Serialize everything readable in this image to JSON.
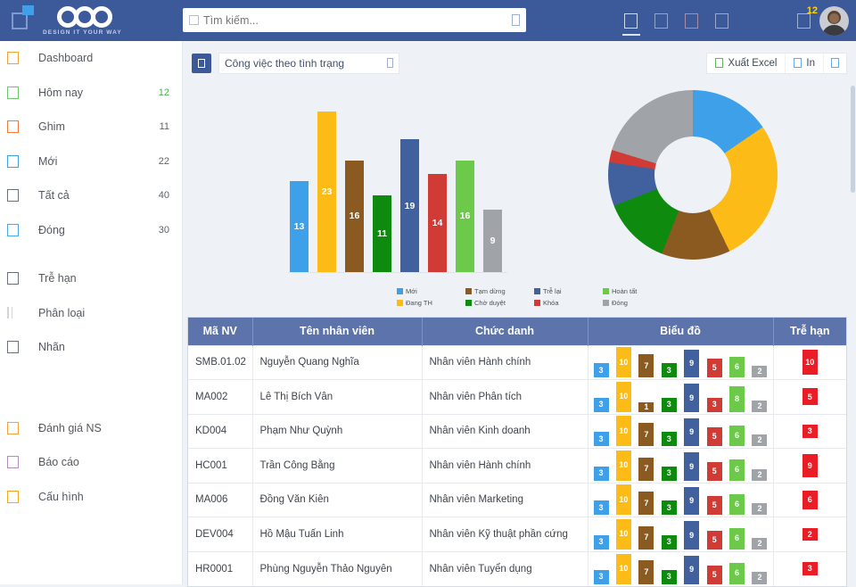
{
  "topbar": {
    "menu_icon": "hamburger-square-icon",
    "logo_tagline": "DESIGN IT YOUR WAY",
    "search": {
      "placeholder": "Tìm kiếm...",
      "value": ""
    },
    "nav_icons": [
      "nav-icon-1",
      "nav-icon-2",
      "nav-icon-3",
      "nav-icon-4"
    ],
    "notification_count": "12",
    "avatar_alt": "user-avatar"
  },
  "sidebar": {
    "items": [
      {
        "label": "Dashboard",
        "count": "",
        "icon": "dashboard-icon",
        "color": "#f0a33c"
      },
      {
        "label": "Hôm nay",
        "count": "12",
        "icon": "today-icon",
        "color": "#6dc46d",
        "count_color": "#4caf50"
      },
      {
        "label": "Ghim",
        "count": "11",
        "icon": "pin-icon",
        "color": "#ef7a3c"
      },
      {
        "label": "Mới",
        "count": "22",
        "icon": "new-icon",
        "color": "#3ea0e8"
      },
      {
        "label": "Tất cả",
        "count": "40",
        "icon": "all-icon",
        "color": "#6b7179"
      },
      {
        "label": "Đóng",
        "count": "30",
        "icon": "closed-icon",
        "color": "#49a9e8"
      }
    ],
    "items2": [
      {
        "label": "Trễ hạn",
        "icon": "overdue-icon",
        "color": "#6b7179"
      },
      {
        "label": "Phân loại",
        "icon": "category-bars-icon",
        "color": "#b8c0c9"
      },
      {
        "label": "Nhãn",
        "icon": "tag-icon",
        "color": "#6b7179"
      }
    ],
    "items3": [
      {
        "label": "Đánh giá NS",
        "icon": "evaluation-icon",
        "color": "#f0a33c"
      },
      {
        "label": "Báo cáo",
        "icon": "report-icon",
        "color": "#b48ac0"
      },
      {
        "label": "Cấu hình",
        "icon": "settings-icon",
        "color": "#f5a623"
      }
    ]
  },
  "panel": {
    "widget_icon": "widget-icon",
    "select_value": "Công việc theo tình trạng",
    "export_excel": "Xuất Excel",
    "print": "In",
    "more_icon": "more-options-icon"
  },
  "chart_data": [
    {
      "type": "bar",
      "title": "Công việc theo tình trạng",
      "categories": [
        "Mới",
        "Đang TH",
        "Tạm dừng",
        "Chờ duyệt",
        "Trễ lại",
        "Khóa",
        "Hoàn tất",
        "Đóng"
      ],
      "values": [
        13,
        23,
        16,
        11,
        19,
        14,
        16,
        9
      ],
      "colors": [
        "#3ea0e8",
        "#fcbb17",
        "#8a5a21",
        "#0e8a0e",
        "#41619e",
        "#d13b36",
        "#6cc94a",
        "#a0a4a8"
      ],
      "xlabel": "",
      "ylabel": "",
      "ylim": [
        0,
        25
      ],
      "grid": false,
      "legend_position": "bottom"
    },
    {
      "type": "pie",
      "title": "Công việc theo tình trạng",
      "labels": [
        "Mới",
        "Đang TH",
        "Tạm dừng",
        "Chờ duyệt",
        "Trễ lại",
        "Khóa",
        "Đóng"
      ],
      "values": [
        13,
        23,
        11,
        11,
        7,
        2,
        17
      ],
      "colors": [
        "#3ea0e8",
        "#fcbb17",
        "#8a5a21",
        "#0e8a0e",
        "#41619e",
        "#d13b36",
        "#a0a4a8"
      ],
      "donut": true
    }
  ],
  "table": {
    "headers": [
      "Mã NV",
      "Tên nhân viên",
      "Chức danh",
      "Biểu đồ",
      "Trễ hạn"
    ],
    "mini_colors": [
      "#3ea0e8",
      "#fcbb17",
      "#8a5a21",
      "#0e8a0e",
      "#41619e",
      "#d13b36",
      "#6cc94a",
      "#a0a4a8"
    ],
    "rows": [
      {
        "code": "SMB.01.02",
        "name": "Nguyễn Quang Nghĩa",
        "role": "Nhân viên Hành chính",
        "chart": [
          3,
          10,
          7,
          3,
          9,
          5,
          6,
          2
        ],
        "late": "10"
      },
      {
        "code": "MA002",
        "name": "Lê Thị Bích Vân",
        "role": "Nhân viên Phân tích",
        "chart": [
          3,
          10,
          1,
          3,
          9,
          3,
          8,
          2
        ],
        "late": "5"
      },
      {
        "code": "KD004",
        "name": "Phạm Như Quỳnh",
        "role": "Nhân viên Kinh doanh",
        "chart": [
          3,
          10,
          7,
          3,
          9,
          5,
          6,
          2
        ],
        "late": "3"
      },
      {
        "code": "HC001",
        "name": "Trần Công Bằng",
        "role": "Nhân viên Hành chính",
        "chart": [
          3,
          10,
          7,
          3,
          9,
          5,
          6,
          2
        ],
        "late": "9"
      },
      {
        "code": "MA006",
        "name": "Đồng Văn Kiên",
        "role": "Nhân viên Marketing",
        "chart": [
          3,
          10,
          7,
          3,
          9,
          5,
          6,
          2
        ],
        "late": "6"
      },
      {
        "code": "DEV004",
        "name": "Hồ Mậu Tuấn Linh",
        "role": "Nhân viên Kỹ thuật phần cứng",
        "chart": [
          3,
          10,
          7,
          3,
          9,
          5,
          6,
          2
        ],
        "late": "2"
      },
      {
        "code": "HR0001",
        "name": "Phùng Nguyễn Thảo Nguyên",
        "role": "Nhân viên Tuyển dụng",
        "chart": [
          3,
          10,
          7,
          3,
          9,
          5,
          6,
          2
        ],
        "late": "3"
      }
    ]
  }
}
